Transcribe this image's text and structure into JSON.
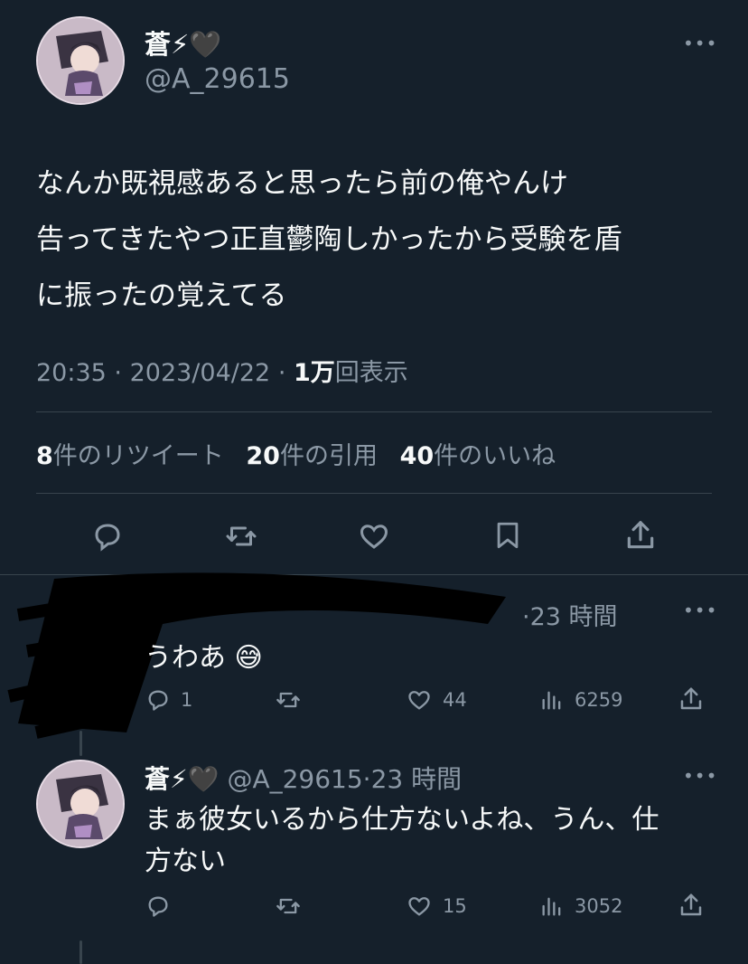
{
  "main_tweet": {
    "display_name": "蒼⚡🖤",
    "handle": "@A_29615",
    "text_lines": [
      "なんか既視感あると思ったら前の俺やんけ",
      "告ってきたやつ正直鬱陶しかったから受験を盾",
      "に振ったの覚えてる"
    ],
    "time": "20:35",
    "sep1": "·",
    "date": "2023/04/22",
    "sep2": "·",
    "views_count": "1万",
    "views_label": "回表示",
    "retweets_count": "8",
    "retweets_label": "件のリツイート",
    "quotes_count": "20",
    "quotes_label": "件の引用",
    "likes_count": "40",
    "likes_label": "件のいいね"
  },
  "reply1": {
    "time_ago": "·23 時間",
    "text": "うわあ 😅",
    "replies": "1",
    "retweets": "",
    "likes": "44",
    "views": "6259"
  },
  "reply2": {
    "display_name": "蒼⚡🖤",
    "handle": "@A_29615",
    "time_ago": "·23 時間",
    "text_lines": [
      "まぁ彼女いるから仕方ないよね、うん、仕",
      "方ない"
    ],
    "replies": "",
    "retweets": "",
    "likes": "15",
    "views": "3052"
  },
  "icons": [
    "more-icon",
    "reply-icon",
    "retweet-icon",
    "like-icon",
    "bookmark-icon",
    "share-icon",
    "views-icon"
  ],
  "colors": {
    "background": "#15202b",
    "text": "#f7f9f9",
    "muted": "#8b98a5",
    "divider": "#38444d"
  }
}
